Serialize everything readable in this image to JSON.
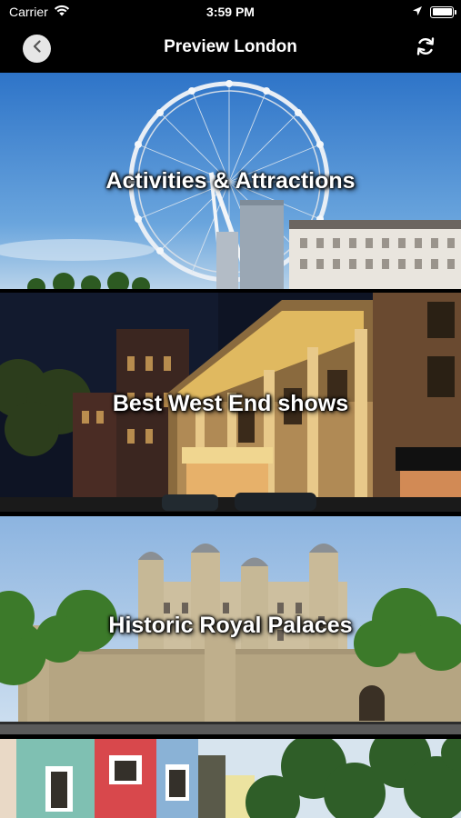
{
  "status_bar": {
    "carrier": "Carrier",
    "time": "3:59 PM",
    "wifi_icon": "wifi-icon",
    "location_icon": "location-arrow-icon",
    "battery_icon": "battery-full-icon"
  },
  "nav": {
    "title": "Preview London",
    "back_icon": "chevron-left-icon",
    "refresh_icon": "refresh-icon"
  },
  "tiles": [
    {
      "label": "Activities & Attractions",
      "image": "london-eye-photo"
    },
    {
      "label": "Best West End shows",
      "image": "west-end-theatre-photo"
    },
    {
      "label": "Historic Royal Palaces",
      "image": "tower-of-london-photo"
    },
    {
      "label": "",
      "image": "colorful-houses-photo"
    }
  ]
}
